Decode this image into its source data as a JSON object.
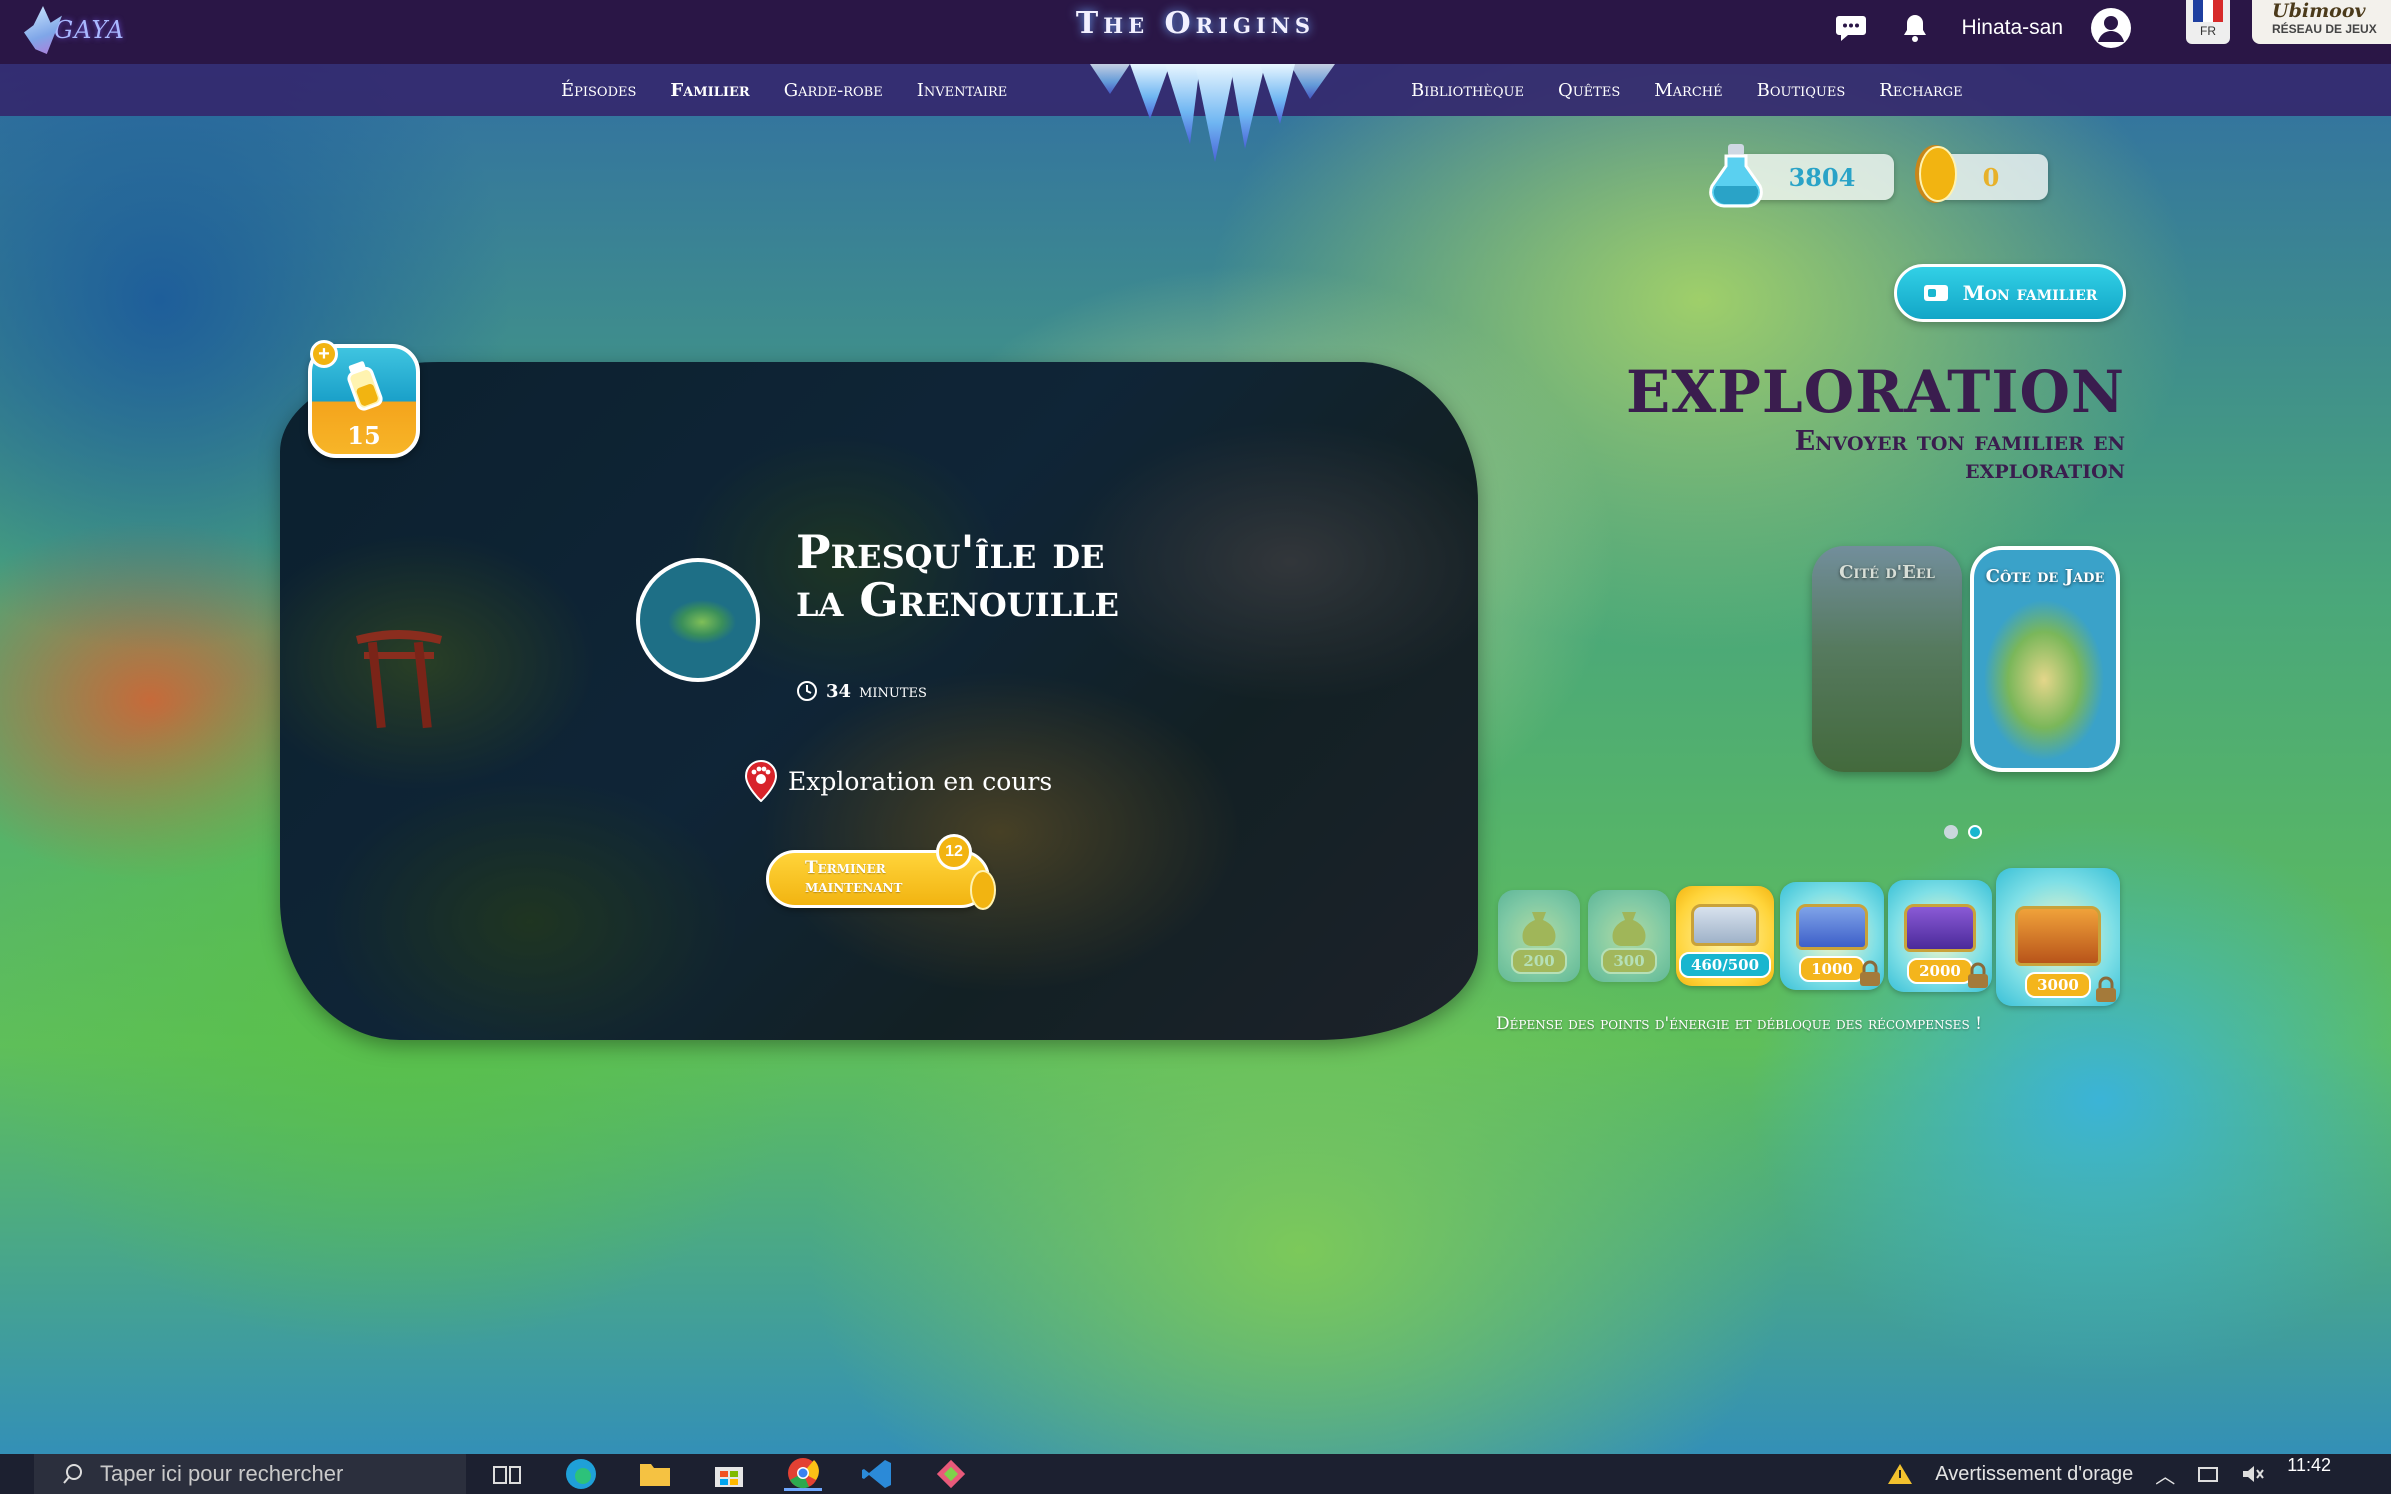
{
  "header": {
    "logo_text": "GAYA",
    "site_title": "The Origins",
    "username": "Hinata-san",
    "lang_label": "FR",
    "partner_brand": "Ubimoov",
    "partner_sub": "RÉSEAU DE JEUX"
  },
  "nav": {
    "left": [
      "Épisodes",
      "Familier",
      "Garde-robe",
      "Inventaire"
    ],
    "right": [
      "Bibliothèque",
      "Quêtes",
      "Marché",
      "Boutiques",
      "Recharge"
    ],
    "active": "Familier"
  },
  "currency": {
    "gems": "3804",
    "coins": "0"
  },
  "energy": {
    "value": "15"
  },
  "familier_button": "Mon familier",
  "exploration": {
    "title": "EXPLORATION",
    "subtitle": "Envoyer ton familier en exploration"
  },
  "map": {
    "location_name": "Presqu'île de la Grenouille",
    "duration_value": "34",
    "duration_unit": "minutes",
    "status": "Exploration en cours",
    "finish_button": "Terminer maintenant",
    "finish_cost": "12"
  },
  "locations": [
    {
      "label": "Cité d'Eel",
      "selected": false
    },
    {
      "label": "Côte de Jade",
      "selected": true
    }
  ],
  "carousel": {
    "pages": 2,
    "active": 2
  },
  "rewards": [
    {
      "value": "200",
      "type": "bag",
      "locked": false,
      "faded": true
    },
    {
      "value": "300",
      "type": "bag",
      "locked": false,
      "faded": true
    },
    {
      "value": "460/500",
      "type": "chest",
      "locked": false,
      "faded": false,
      "in_progress": true
    },
    {
      "value": "1000",
      "type": "chest",
      "locked": true,
      "faded": false
    },
    {
      "value": "2000",
      "type": "chest",
      "locked": true,
      "faded": false
    },
    {
      "value": "3000",
      "type": "chest",
      "locked": true,
      "faded": false
    }
  ],
  "rewards_caption": "Dépense des points d'énergie et débloque des récompenses !",
  "taskbar": {
    "search_placeholder": "Taper ici pour rechercher",
    "weather_alert": "Avertissement d'orage",
    "clock": "11:42"
  },
  "colors": {
    "header_bg": "#2a1646",
    "nav_bg": "#34286e",
    "accent_cyan": "#19b6cf",
    "accent_gold": "#f2b411",
    "title_purple": "#3a1d4e"
  }
}
